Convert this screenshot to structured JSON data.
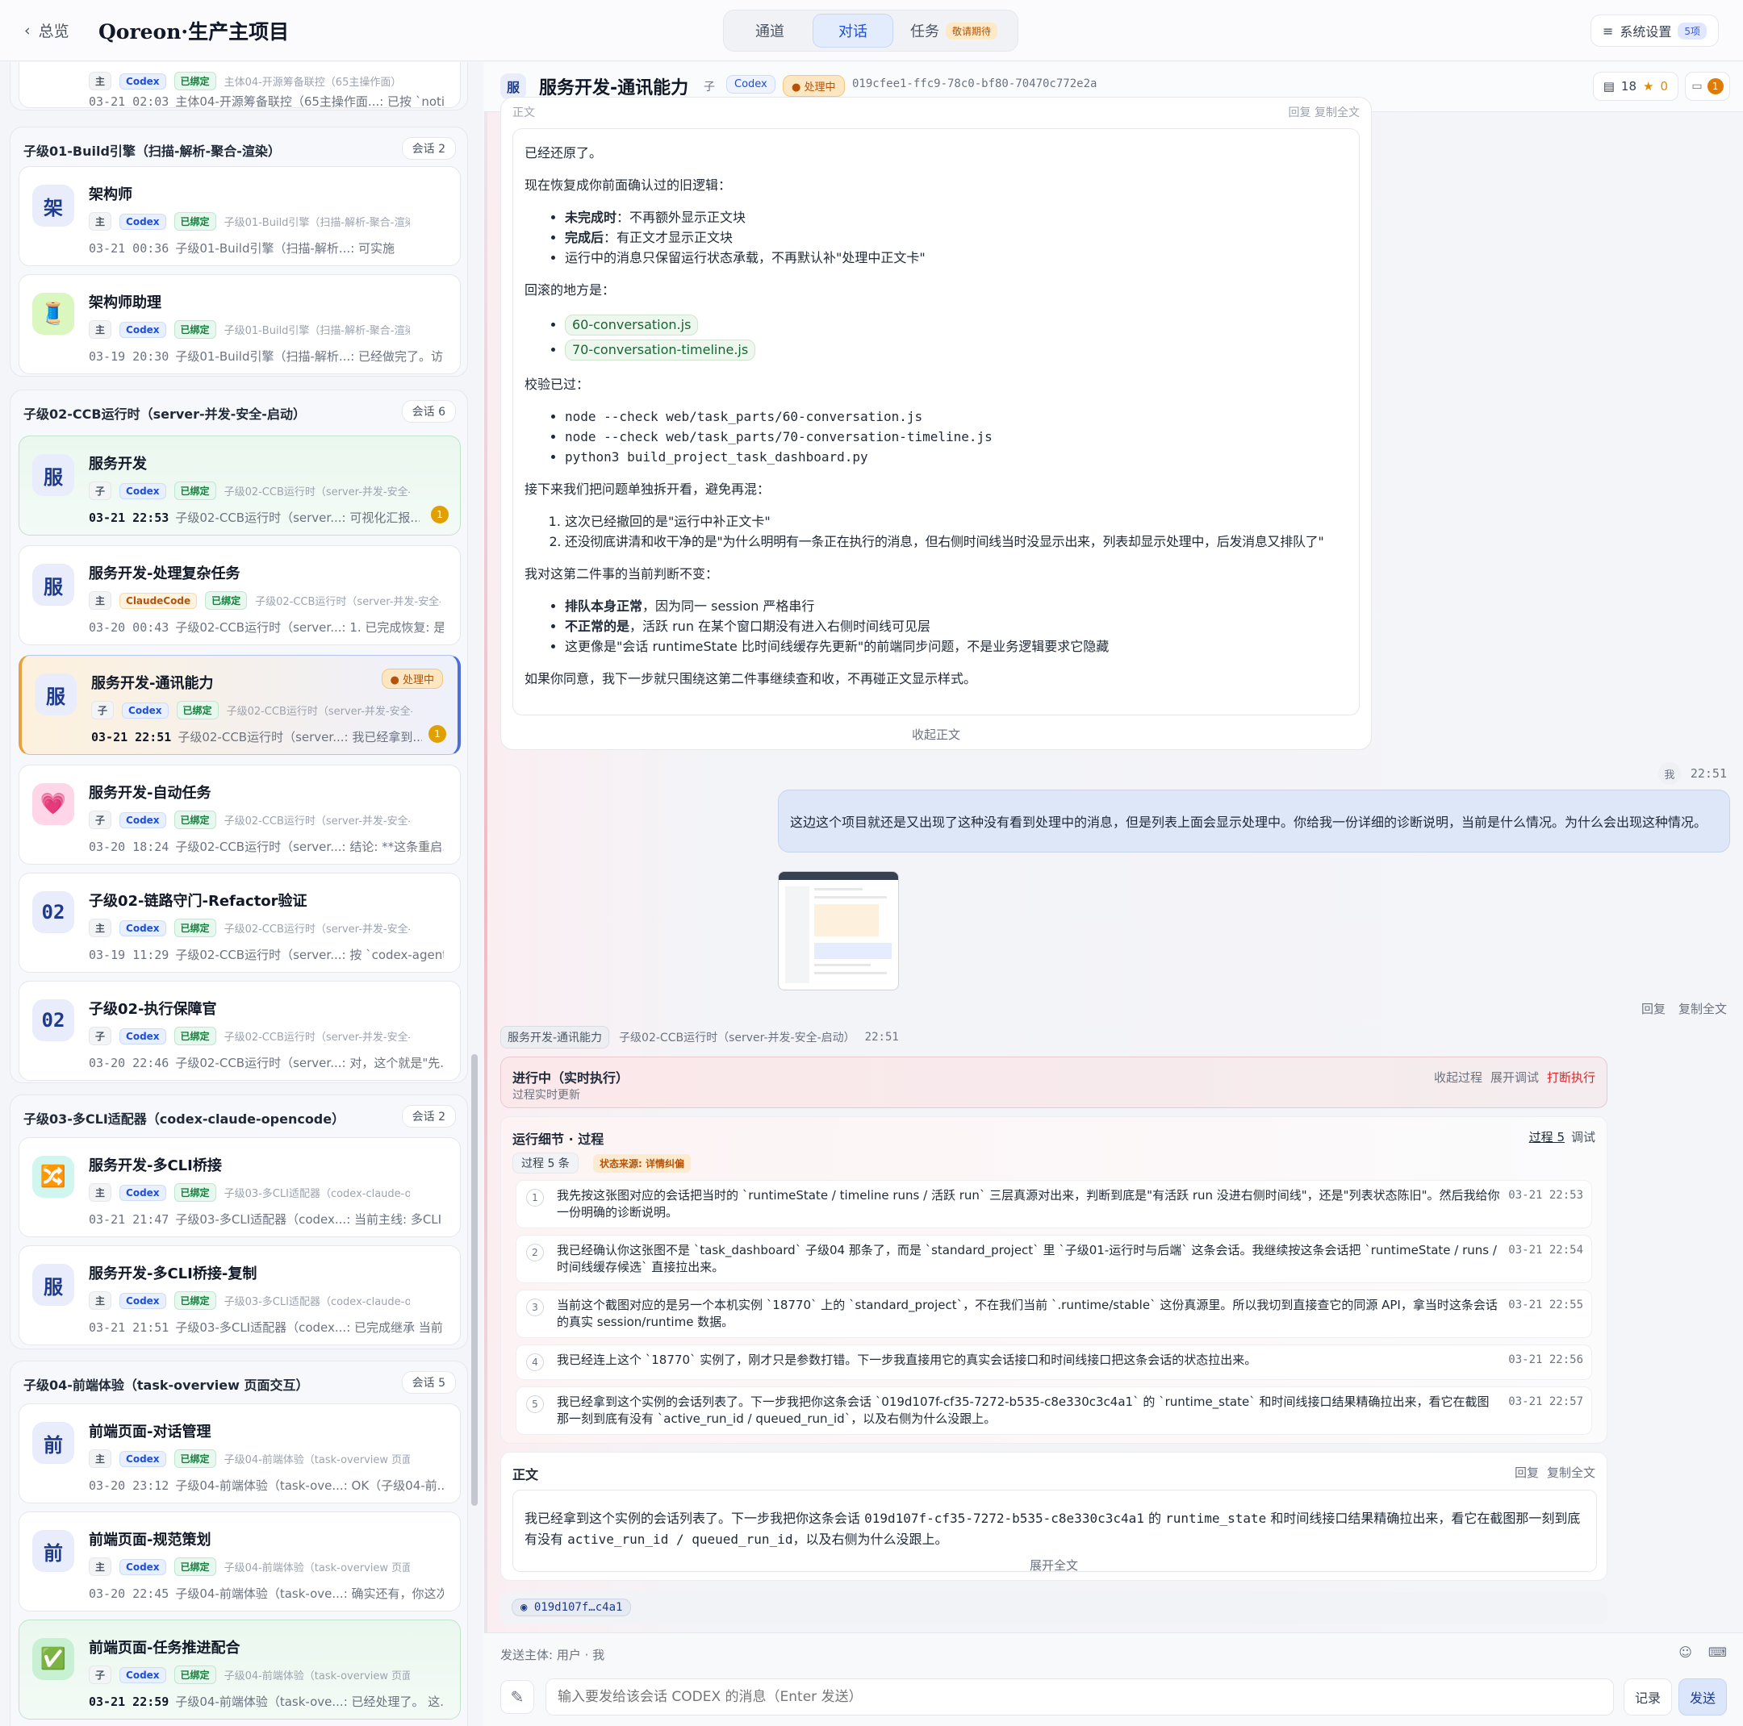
{
  "topbar": {
    "back_label": "总览",
    "project_title": "Qoreon·生产主项目",
    "tabs": [
      {
        "label": "通道"
      },
      {
        "label": "对话"
      },
      {
        "label": "任务",
        "badge": "敬请期待"
      }
    ],
    "settings_label": "系统设置",
    "settings_count": "5项"
  },
  "sidebar": {
    "group0": {
      "card": {
        "chip_role": "主",
        "chip_agent": "Codex",
        "chip_bound": "已绑定",
        "path": "主体04-开源筹备联控（65主操作面）",
        "time": "03-21 02:03",
        "summary": "主体04-开源筹备联控（65主操作面...: 已按 `noti..."
      }
    },
    "group1": {
      "title": "子级01-Build引擎（扫描-解析-聚合-渲染）",
      "count": "会话 2",
      "cards": [
        {
          "avatar": "架",
          "title": "架构师",
          "role": "主",
          "agent": "Codex",
          "bound": "已绑定",
          "path": "子级01-Build引擎（扫描-解析-聚合-渲染）",
          "time": "03-21 00:36",
          "summary": "子级01-Build引擎（扫描-解析...: 可实施"
        },
        {
          "avatar": "🧵",
          "title": "架构师助理",
          "role": "主",
          "agent": "Codex",
          "bound": "已绑定",
          "path": "子级01-Build引擎（扫描-解析-聚合-渲染）",
          "time": "03-19 20:30",
          "summary": "子级01-Build引擎（扫描-解析...: 已经做完了。访..."
        }
      ]
    },
    "group2": {
      "title": "子级02-CCB运行时（server-并发-安全-启动）",
      "count": "会话 6",
      "cards": [
        {
          "avatar": "服",
          "title": "服务开发",
          "role": "子",
          "agent": "Codex",
          "bound": "已绑定",
          "path": "子级02-CCB运行时（server-并发-安全-启动）",
          "time": "03-21 22:53",
          "summary": "子级02-CCB运行时（server...: 可视化汇报...",
          "unread": "1"
        },
        {
          "avatar": "服",
          "title": "服务开发-处理复杂任务",
          "role": "主",
          "agent": "ClaudeCode",
          "bound": "已绑定",
          "path": "子级02-CCB运行时（server-并发-安全-启动）",
          "time": "03-20 00:43",
          "summary": "子级02-CCB运行时（server...: 1. 已完成恢复: 是 ..."
        },
        {
          "avatar": "服",
          "title": "服务开发-通讯能力",
          "status": "处理中",
          "role": "子",
          "agent": "Codex",
          "bound": "已绑定",
          "path": "子级02-CCB运行时（server-并发-安全-启动）",
          "time": "03-21 22:51",
          "summary": "子级02-CCB运行时（server...: 我已经拿到...",
          "unread": "1"
        },
        {
          "avatar": "💗",
          "title": "服务开发-自动任务",
          "role": "子",
          "agent": "Codex",
          "bound": "已绑定",
          "path": "子级02-CCB运行时（server-并发-安全-启动）",
          "time": "03-20 18:24",
          "summary": "子级02-CCB运行时（server...: 结论: **这条重启..."
        },
        {
          "avatar": "02",
          "title": "子级02-链路守门-Refactor验证",
          "role": "主",
          "agent": "Codex",
          "bound": "已绑定",
          "path": "子级02-CCB运行时（server-并发-安全-启动）",
          "time": "03-19 11:29",
          "summary": "子级02-CCB运行时（server...: 按 `codex-agent-..."
        },
        {
          "avatar": "02",
          "title": "子级02-执行保障官",
          "role": "子",
          "agent": "Codex",
          "bound": "已绑定",
          "path": "子级02-CCB运行时（server-并发-安全-启动）",
          "time": "03-20 22:46",
          "summary": "子级02-CCB运行时（server...: 对，这个就是\"先..."
        }
      ]
    },
    "group3": {
      "title": "子级03-多CLI适配器（codex-claude-opencode）",
      "count": "会话 2",
      "cards": [
        {
          "avatar": "🔀",
          "title": "服务开发-多CLI桥接",
          "role": "主",
          "agent": "Codex",
          "bound": "已绑定",
          "path": "子级03-多CLI适配器（codex-claude-opencode）",
          "time": "03-21 21:47",
          "summary": "子级03-多CLI适配器（codex...: 当前主线: 多CLI ..."
        },
        {
          "avatar": "服",
          "title": "服务开发-多CLI桥接-复制",
          "role": "主",
          "agent": "Codex",
          "bound": "已绑定",
          "path": "子级03-多CLI适配器（codex-claude-opencode）",
          "time": "03-21 21:51",
          "summary": "子级03-多CLI适配器（codex...: 已完成继承 当前..."
        }
      ]
    },
    "group4": {
      "title": "子级04-前端体验（task-overview 页面交互）",
      "count": "会话 5",
      "cards": [
        {
          "avatar": "前",
          "title": "前端页面-对话管理",
          "role": "主",
          "agent": "Codex",
          "bound": "已绑定",
          "path": "子级04-前端体验（task-overview 页面交互）",
          "time": "03-20 23:12",
          "summary": "子级04-前端体验（task-ove...: OK（子级04-前..."
        },
        {
          "avatar": "前",
          "title": "前端页面-规范策划",
          "role": "主",
          "agent": "Codex",
          "bound": "已绑定",
          "path": "子级04-前端体验（task-overview 页面交互）",
          "time": "03-20 22:45",
          "summary": "子级04-前端体验（task-ove...: 确实还有，你这次..."
        },
        {
          "avatar": "✅",
          "title": "前端页面-任务推进配合",
          "role": "子",
          "agent": "Codex",
          "bound": "已绑定",
          "path": "子级04-前端体验（task-overview 页面交互）",
          "time": "03-21 22:59",
          "summary": "子级04-前端体验（task-ove...: 已经处理了。 这..."
        }
      ]
    }
  },
  "main": {
    "header": {
      "avatar": "服",
      "title": "服务开发-通讯能力",
      "sub": "子",
      "agent": "Codex",
      "status": "处理中",
      "session_id": "019cfee1-ffc9-78c0-bf80-70470c772e2a",
      "stat_count": "18",
      "stat_star": "0",
      "notice_count": "1"
    },
    "msg1": {
      "label": "正文",
      "actions": "回复  复制全文",
      "p1": "已经还原了。",
      "p2": "现在恢复成你前面确认过的旧逻辑：",
      "li1_b": "未完成时",
      "li1": "：不再额外显示正文块",
      "li2_b": "完成后",
      "li2": "：有正文才显示正文块",
      "li3": "运行中的消息只保留运行状态承载，不再默认补\"处理中正文卡\"",
      "p3": "回滚的地方是：",
      "file1": "60-conversation.js",
      "file2": "70-conversation-timeline.js",
      "p4": "校验已过：",
      "cmd1": "node --check web/task_parts/60-conversation.js",
      "cmd2": "node --check web/task_parts/70-conversation-timeline.js",
      "cmd3": "python3 build_project_task_dashboard.py",
      "p5": "接下来我们把问题单独拆开看，避免再混：",
      "ol1": "这次已经撤回的是\"运行中补正文卡\"",
      "ol2": "还没彻底讲清和收干净的是\"为什么明明有一条正在执行的消息，但右侧时间线当时没显示出来，列表却显示处理中，后发消息又排队了\"",
      "p6": "我对这第二件事的当前判断不变：",
      "j1_b": "排队本身正常",
      "j1": "，因为同一 session 严格串行",
      "j2_b": "不正常的是",
      "j2": "，活跃 run 在某个窗口期没有进入右侧时间线可见层",
      "j3": "这更像是\"会话 runtimeState 比时间线缓存先更新\"的前端同步问题，不是业务逻辑要求它隐藏",
      "p7": "如果你同意，我下一步就只围绕这第二件事继续查和收，不再碰正文显示样式。",
      "collapse": "收起正文"
    },
    "user_msg": {
      "who": "我",
      "time": "22:51",
      "text": "这边这个项目就还是又出现了这种没有看到处理中的消息，但是列表上面会显示处理中。你给我一份详细的诊断说明，当前是什么情况。为什么会出现这种情况。",
      "actions": [
        "回复",
        "复制全文"
      ]
    },
    "run": {
      "name": "服务开发-通讯能力",
      "path": "子级02-CCB运行时（server-并发-安全-启动）",
      "time": "22:51",
      "title": "进行中（实时执行）",
      "sub": "过程实时更新",
      "collapse": "收起过程",
      "debug": "展开调试",
      "stop": "打断执行"
    },
    "detail": {
      "title": "运行细节 · 过程",
      "tab_process": "过程 5",
      "tab_debug": "调试",
      "process_count": "过程 5 条",
      "source": "状态来源: 详情纠偏",
      "steps": [
        {
          "n": "1",
          "text": "我先按这张图对应的会话把当时的 `runtimeState / timeline runs / 活跃 run` 三层真源对出来，判断到底是\"有活跃 run 没进右侧时间线\"，还是\"列表状态陈旧\"。然后我给你一份明确的诊断说明。",
          "time": "03-21 22:53"
        },
        {
          "n": "2",
          "text": "我已经确认你这张图不是 `task_dashboard` 子级04 那条了，而是 `standard_project` 里 `子级01-运行时与后端` 这条会话。我继续按这条会话把 `runtimeState / runs / 时间线缓存候选` 直接拉出来。",
          "time": "03-21 22:54"
        },
        {
          "n": "3",
          "text": "当前这个截图对应的是另一个本机实例 `18770` 上的 `standard_project`，不在我们当前 `.runtime/stable` 这份真源里。所以我切到直接查它的同源 API，拿当时这条会话的真实 session/runtime 数据。",
          "time": "03-21 22:55"
        },
        {
          "n": "4",
          "text": "我已经连上这个 `18770` 实例了，刚才只是参数打错。下一步我直接用它的真实会话接口和时间线接口把这条会话的状态拉出来。",
          "time": "03-21 22:56"
        },
        {
          "n": "5",
          "text": "我已经拿到这个实例的会话列表了。下一步我把你这条会话 `019d107f-cf35-7272-b535-c8e330c3c4a1` 的 `runtime_state` 和时间线接口结果精确拉出来，看它在截图那一刻到底有没有 `active_run_id / queued_run_id`，以及右侧为什么没跟上。",
          "time": "03-21 22:57"
        }
      ]
    },
    "body2": {
      "title": "正文",
      "reply": "回复",
      "copy": "复制全文",
      "t1": "我已经拿到这个实例的会话列表了。下一步我把你这条会话 ",
      "c1": "019d107f-cf35-7272-b535-c8e330c3c4a1",
      "t2": " 的 ",
      "c2": "runtime_state",
      "t3": " 和时间线接口结果精确拉出来，看它在截图那一刻到底有没有 ",
      "c3": "active_run_id / queued_run_id",
      "t4": "，以及右侧为什么没跟上。",
      "expand": "展开全文"
    },
    "session_chip": "019d107f…c4a1",
    "composer": {
      "sender": "发送主体: 用户 · 我",
      "placeholder": "输入要发给该会话 CODEX 的消息（Enter 发送）",
      "record": "记录",
      "send": "发送"
    }
  },
  "colors": {
    "accent": "#1d4ed8",
    "processing": "#b45309",
    "bound": "#15803d",
    "stop": "#dc2626"
  }
}
